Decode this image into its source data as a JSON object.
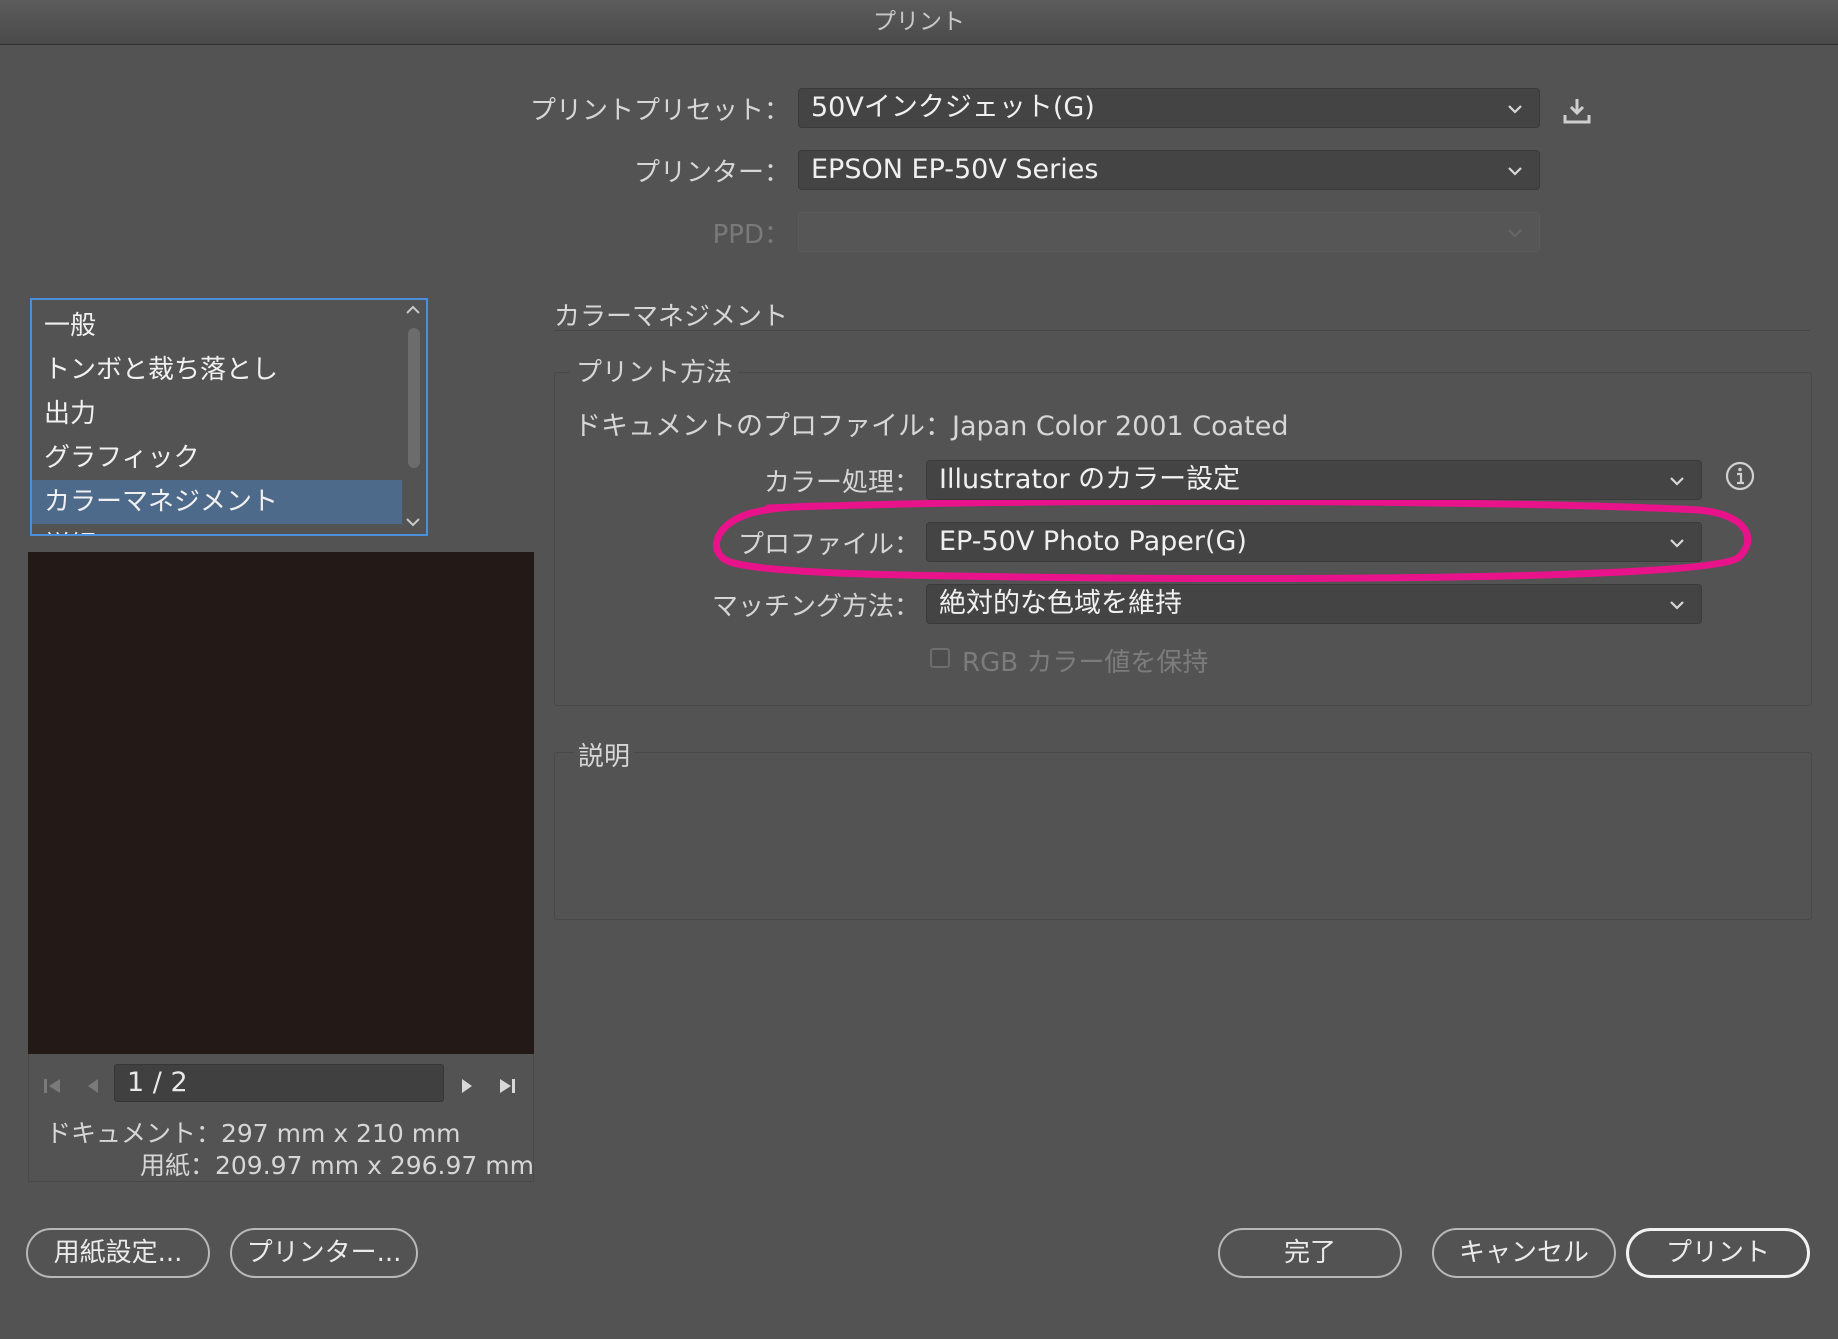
{
  "window": {
    "title": "プリント"
  },
  "preset": {
    "label": "プリントプリセット：",
    "value": "50Vインクジェット(G)"
  },
  "printer": {
    "label": "プリンター：",
    "value": "EPSON EP-50V Series"
  },
  "ppd": {
    "label": "PPD：",
    "value": ""
  },
  "sidebar": {
    "items": [
      {
        "label": "一般"
      },
      {
        "label": "トンボと裁ち落とし"
      },
      {
        "label": "出力"
      },
      {
        "label": "グラフィック"
      },
      {
        "label": "カラーマネジメント",
        "selected": true
      },
      {
        "label": "詳細"
      }
    ]
  },
  "color_management": {
    "title": "カラーマネジメント",
    "print_method_title": "プリント方法",
    "document_profile": "ドキュメントのプロファイル：Japan Color 2001 Coated",
    "color_handling": {
      "label": "カラー処理：",
      "value": "Illustrator のカラー設定"
    },
    "profile": {
      "label": "プロファイル：",
      "value": "EP-50V Photo Paper(G)",
      "highlight_color": "#e8138a"
    },
    "rendering_intent": {
      "label": "マッチング方法：",
      "value": "絶対的な色域を維持"
    },
    "preserve_rgb": {
      "label": "RGB カラー値を保持",
      "checked": false,
      "enabled": false
    }
  },
  "description": {
    "title": "説明",
    "text": ""
  },
  "preview_nav": {
    "page": "1 / 2",
    "document_size": "ドキュメント：297 mm x 210 mm",
    "paper_size": "用紙：209.97 mm x 296.97 mm"
  },
  "buttons": {
    "page_setup": "用紙設定...",
    "printer": "プリンター...",
    "done": "完了",
    "cancel": "キャンセル",
    "print": "プリント"
  },
  "colors": {
    "background": "#535353",
    "selection": "#4d6a8a",
    "focus_ring": "#4a8fd8",
    "annotation": "#e8138a"
  }
}
